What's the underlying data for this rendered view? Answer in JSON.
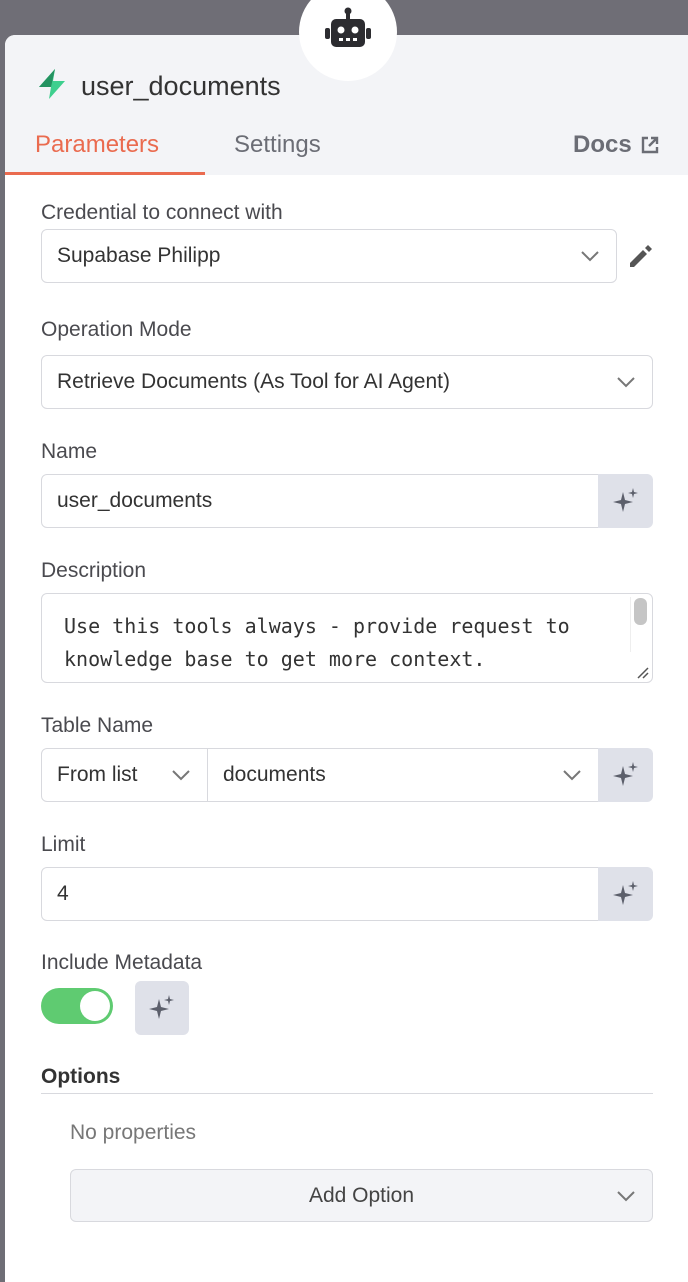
{
  "node": {
    "title": "user_documents"
  },
  "tabs": {
    "parameters": "Parameters",
    "settings": "Settings",
    "docs": "Docs"
  },
  "credential": {
    "label": "Credential to connect with",
    "value": "Supabase Philipp"
  },
  "operation": {
    "label": "Operation Mode",
    "value": "Retrieve Documents (As Tool for AI Agent)"
  },
  "name": {
    "label": "Name",
    "value": "user_documents"
  },
  "description": {
    "label": "Description",
    "value": "Use this tools always - provide request to knowledge base to get more context."
  },
  "table": {
    "label": "Table Name",
    "mode": "From list",
    "value": "documents"
  },
  "limit": {
    "label": "Limit",
    "value": "4"
  },
  "metadata": {
    "label": "Include Metadata",
    "enabled": true
  },
  "options": {
    "label": "Options",
    "empty_text": "No properties",
    "add_label": "Add Option"
  },
  "colors": {
    "accent": "#ea6b4f",
    "toggle_on": "#5fcb71",
    "ai_button": "#dfe1e9"
  },
  "icons": [
    "robot-icon",
    "supabase-bolt-icon",
    "external-link-icon",
    "pencil-icon",
    "chevron-down-icon",
    "sparkles-icon"
  ]
}
